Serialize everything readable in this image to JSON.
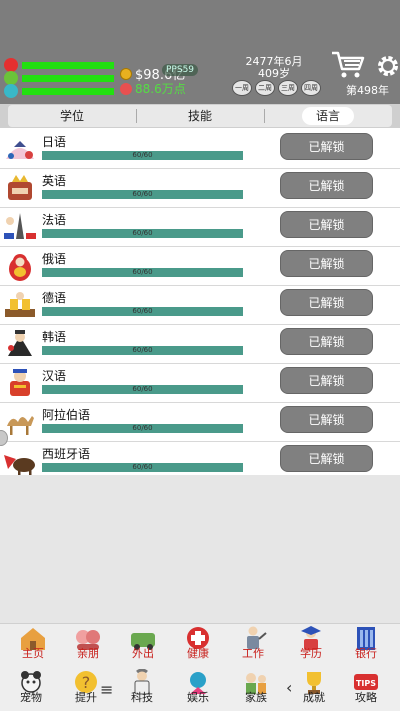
{
  "header": {
    "money": "$98.6亿",
    "pps": "PPS59",
    "fame": "88.6万点",
    "date": "2477年6月",
    "age": "409岁",
    "weeks": [
      "一周",
      "二周",
      "三周",
      "四周"
    ],
    "week_count": "第498年"
  },
  "tabs": [
    {
      "label": "学位",
      "active": false
    },
    {
      "label": "技能",
      "active": false
    },
    {
      "label": "语言",
      "active": true
    }
  ],
  "languages": [
    {
      "name": "日语",
      "progress": "60/60",
      "button": "已解锁"
    },
    {
      "name": "英语",
      "progress": "60/60",
      "button": "已解锁"
    },
    {
      "name": "法语",
      "progress": "60/60",
      "button": "已解锁"
    },
    {
      "name": "俄语",
      "progress": "60/60",
      "button": "已解锁"
    },
    {
      "name": "德语",
      "progress": "60/60",
      "button": "已解锁"
    },
    {
      "name": "韩语",
      "progress": "60/60",
      "button": "已解锁"
    },
    {
      "name": "汉语",
      "progress": "60/60",
      "button": "已解锁"
    },
    {
      "name": "阿拉伯语",
      "progress": "60/60",
      "button": "已解锁"
    },
    {
      "name": "西班牙语",
      "progress": "60/60",
      "button": "已解锁"
    }
  ],
  "nav_top": [
    {
      "label": "主页",
      "icon": "home-icon"
    },
    {
      "label": "亲朋",
      "icon": "friends-icon"
    },
    {
      "label": "外出",
      "icon": "outing-icon"
    },
    {
      "label": "健康",
      "icon": "health-icon"
    },
    {
      "label": "工作",
      "icon": "work-icon"
    },
    {
      "label": "学历",
      "icon": "education-icon"
    },
    {
      "label": "银行",
      "icon": "bank-icon"
    }
  ],
  "nav_bottom": [
    {
      "label": "宠物",
      "icon": "pet-icon"
    },
    {
      "label": "提升",
      "icon": "upgrade-icon"
    },
    {
      "label": "科技",
      "icon": "tech-icon"
    },
    {
      "label": "娱乐",
      "icon": "entertainment-icon"
    },
    {
      "label": "家族",
      "icon": "family-icon"
    },
    {
      "label": "成就",
      "icon": "achievement-icon"
    },
    {
      "label": "攻略",
      "icon": "guide-icon"
    }
  ],
  "colors": {
    "header_bg": "#7d7d7d",
    "stat_bar": "#22e010",
    "progress_bar": "#4a9a8a",
    "button_bg": "#808080",
    "nav_label": "#c8201c"
  }
}
